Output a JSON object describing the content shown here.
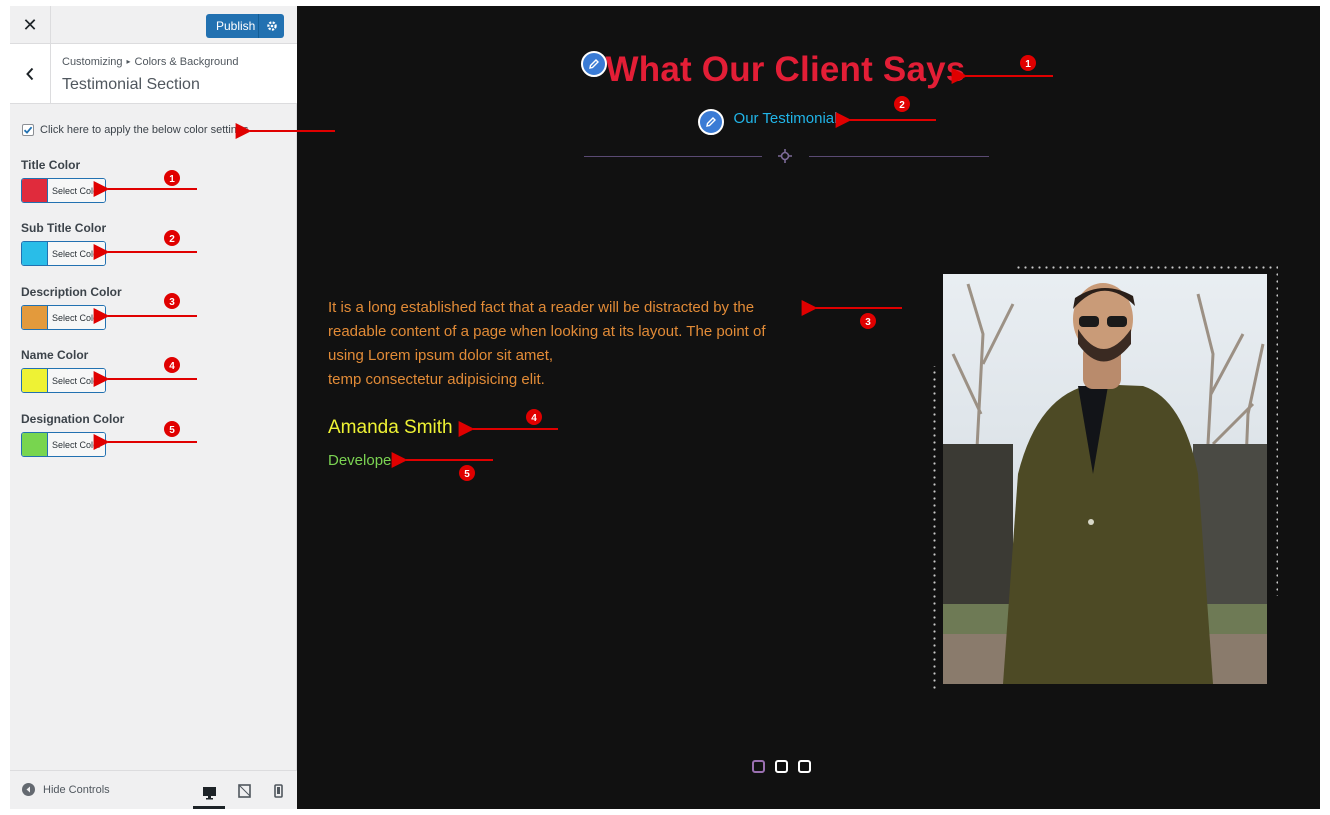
{
  "topbar": {
    "close_label": "✕",
    "publish_label": "Publish"
  },
  "section": {
    "breadcrumb_root": "Customizing",
    "breadcrumb_sep": "▸",
    "breadcrumb_parent": "Colors & Background",
    "title": "Testimonial Section"
  },
  "settings": {
    "apply_label": "Click here to apply the below color settings",
    "apply_checked": true,
    "colors": [
      {
        "label": "Title Color",
        "button": "Select Color",
        "value": "#e02b3c"
      },
      {
        "label": "Sub Title Color",
        "button": "Select Color",
        "value": "#29bde8"
      },
      {
        "label": "Description Color",
        "button": "Select Color",
        "value": "#e39a3c"
      },
      {
        "label": "Name Color",
        "button": "Select Color",
        "value": "#eef234"
      },
      {
        "label": "Designation Color",
        "button": "Select Color",
        "value": "#78d54f"
      }
    ]
  },
  "footer": {
    "hide_controls": "Hide Controls"
  },
  "preview": {
    "title": "What Our Client Says",
    "subtitle": "Our Testimonial",
    "description_lines": [
      "It is a long established fact that a reader will be distracted by the",
      "readable content of a page when looking at its layout. The point of",
      "using Lorem ipsum dolor sit amet,",
      "temp consectetur adipisicing elit."
    ],
    "name": "Amanda Smith",
    "designation": "Developer",
    "pager_count": 3,
    "pager_active": 0
  },
  "annotations": [
    "1",
    "2",
    "3",
    "4",
    "5",
    "1",
    "2",
    "3",
    "4",
    "5"
  ],
  "colors": {
    "accent": "#2271b1",
    "arrow": "#e00000",
    "preview_bg": "#111111"
  }
}
